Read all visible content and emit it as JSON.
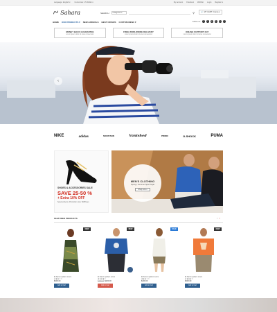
{
  "topbar": {
    "language": "Language: English ▾",
    "currency": "Currencies: US Dollar ▾",
    "links": [
      "My account",
      "Checkout",
      "Wishlist",
      "Login",
      "Register ▾"
    ]
  },
  "header": {
    "logo_text": "Sahara",
    "search_label": "SEARCH",
    "search_category": "Categories ▾",
    "search_placeholder": "",
    "cart_label": "MY CART",
    "cart_items": "0 items ▾"
  },
  "nav": {
    "items": [
      "HOME",
      "OUR PRODUCTS ▾",
      "NEW ARRIVALS",
      "BEST OFFERS",
      "CUSTOM MENU ▾"
    ],
    "follow_label": "Follow us:",
    "social": [
      "f",
      "t",
      "g",
      "in",
      "p",
      "v"
    ]
  },
  "features": [
    {
      "title": "MONEY BACK GUARANTEE",
      "sub": "Lorem ipsum dolor sit amet consectetur"
    },
    {
      "title": "FREE WORLDWIDE DELIVERY",
      "sub": "Lorem ipsum dolor sit amet consectetur"
    },
    {
      "title": "ONLINE SUPPORT 24/7",
      "sub": "Lorem ipsum dolor sit amet consectetur"
    }
  ],
  "brands": [
    "NIKE",
    "adidas",
    "MOUNTAIN",
    "Vanished",
    "PRIMO",
    "G-SHOCK",
    "PUMA"
  ],
  "promo_left": {
    "line1": "SHOES & ACCESSORIES SALE",
    "line2": "SAVE 25-50 %",
    "line3": "+ Extra 10% OFF",
    "line4": "Selected items. Promotion code: SMShoes"
  },
  "promo_right": {
    "title": "MEN'S CLOTHING",
    "sub": "Spring / Summer Sport Style",
    "button": "Shop now »"
  },
  "featured": {
    "title": "FEATURED PRODUCTS",
    "prev": "‹",
    "next": "›"
  },
  "products": [
    {
      "name": "Et harum quidem rerum",
      "stars": "★★★☆☆",
      "old": "",
      "price": "$200.00",
      "button": "Add to Cart",
      "badge": "NEW"
    },
    {
      "name": "Et harum quidem rerum",
      "stars": "★★★★☆",
      "old": "$250.00",
      "price": "$200.00",
      "button": "Add to Cart",
      "badge": "NEW"
    },
    {
      "name": "Et harum quidem rerum",
      "stars": "★★★☆☆",
      "old": "",
      "price": "$200.00",
      "button": "Add to Cart",
      "badge": "SALE"
    },
    {
      "name": "Et harum quidem rerum",
      "stars": "★★★★☆",
      "old": "",
      "price": "$200.00",
      "button": "Add to Cart",
      "badge": "NEW"
    }
  ],
  "colors": {
    "accent": "#d12a1d",
    "nav_active": "#1f5a9a",
    "button": "#2f5f8f"
  }
}
